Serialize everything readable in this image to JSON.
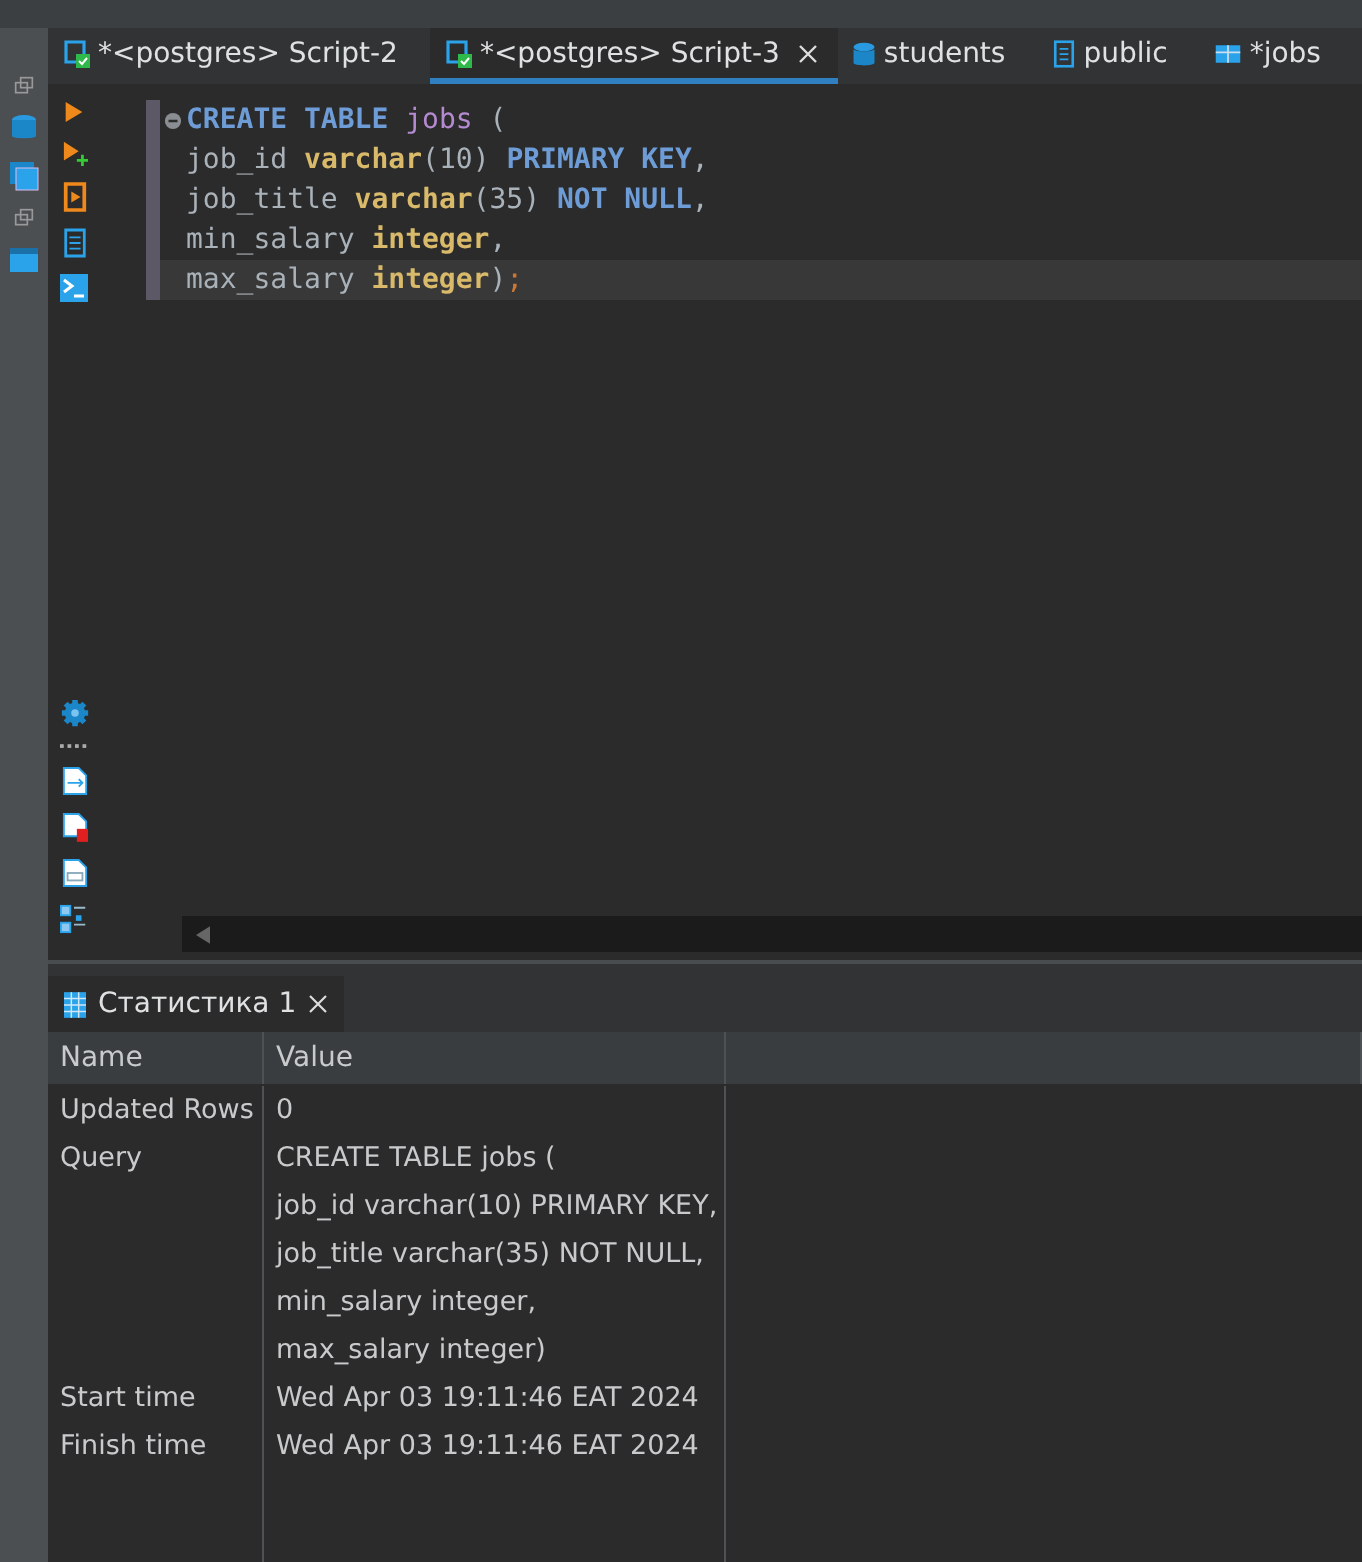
{
  "editor_tabs": [
    {
      "label": "*<postgres> Script-2",
      "kind": "script",
      "selected": false,
      "closable": false
    },
    {
      "label": "*<postgres> Script-3",
      "kind": "script",
      "selected": true,
      "closable": true
    },
    {
      "label": "students",
      "kind": "database",
      "selected": false,
      "closable": false
    },
    {
      "label": "public",
      "kind": "schema",
      "selected": false,
      "closable": false
    },
    {
      "label": "*jobs",
      "kind": "table",
      "selected": false,
      "closable": false
    }
  ],
  "code_lines": [
    {
      "current": false,
      "folding": true,
      "tokens": [
        {
          "kind": "keyword",
          "text": "CREATE TABLE"
        },
        {
          "kind": "name",
          "text": " jobs"
        },
        {
          "kind": "plain",
          "text": " ("
        }
      ]
    },
    {
      "current": false,
      "folding": false,
      "tokens": [
        {
          "kind": "plain",
          "text": "job_id "
        },
        {
          "kind": "type",
          "text": "varchar"
        },
        {
          "kind": "plain",
          "text": "(10) "
        },
        {
          "kind": "keyword",
          "text": "PRIMARY KEY"
        },
        {
          "kind": "plain",
          "text": ","
        }
      ]
    },
    {
      "current": false,
      "folding": false,
      "tokens": [
        {
          "kind": "plain",
          "text": "job_title "
        },
        {
          "kind": "type",
          "text": "varchar"
        },
        {
          "kind": "plain",
          "text": "(35) "
        },
        {
          "kind": "keyword",
          "text": "NOT NULL"
        },
        {
          "kind": "plain",
          "text": ","
        }
      ]
    },
    {
      "current": false,
      "folding": false,
      "tokens": [
        {
          "kind": "plain",
          "text": "min_salary "
        },
        {
          "kind": "type",
          "text": "integer"
        },
        {
          "kind": "plain",
          "text": ","
        }
      ]
    },
    {
      "current": true,
      "folding": false,
      "tokens": [
        {
          "kind": "plain",
          "text": "max_salary "
        },
        {
          "kind": "type",
          "text": "integer"
        },
        {
          "kind": "plain",
          "text": ")"
        },
        {
          "kind": "semicolon",
          "text": ";"
        }
      ]
    }
  ],
  "results_tab": {
    "label": "Статистика 1"
  },
  "results_table": {
    "columns": [
      "Name",
      "Value"
    ],
    "rows": [
      {
        "name": "Updated Rows",
        "value": [
          "0"
        ]
      },
      {
        "name": "Query",
        "value": [
          "CREATE TABLE jobs (",
          "job_id varchar(10) PRIMARY KEY,",
          "job_title varchar(35) NOT NULL,",
          "min_salary integer,",
          "max_salary integer)"
        ]
      },
      {
        "name": "Start time",
        "value": [
          "Wed Apr 03 19:11:46 EAT 2024"
        ]
      },
      {
        "name": "Finish time",
        "value": [
          "Wed Apr 03 19:11:46 EAT 2024"
        ]
      }
    ]
  }
}
